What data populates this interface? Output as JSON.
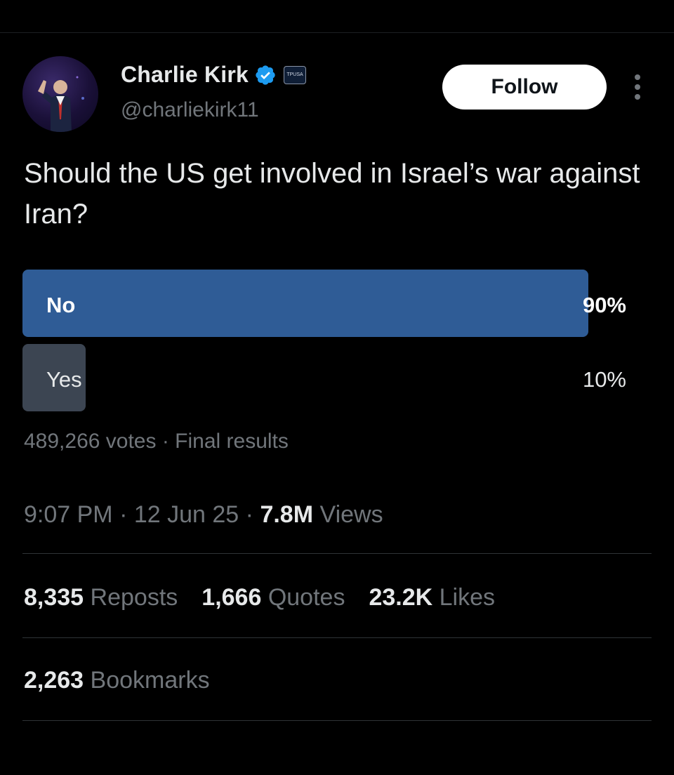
{
  "author": {
    "name": "Charlie Kirk",
    "handle": "@charliekirk11",
    "verified": true,
    "org_badge_text": "TPUSA"
  },
  "follow_label": "Follow",
  "question": "Should the US get involved in Israel’s war against Iran?",
  "poll": {
    "options": [
      {
        "label": "No",
        "percent_text": "90%",
        "fraction": 0.9
      },
      {
        "label": "Yes",
        "percent_text": "10%",
        "fraction": 0.1
      }
    ],
    "votes": "489,266 votes",
    "separator": "·",
    "status": "Final results"
  },
  "timestamp": {
    "time": "9:07 PM",
    "date": "12 Jun 25",
    "views_count": "7.8M",
    "views_label": "Views"
  },
  "stats": {
    "reposts_count": "8,335",
    "reposts_label": "Reposts",
    "quotes_count": "1,666",
    "quotes_label": "Quotes",
    "likes_count": "23.2K",
    "likes_label": "Likes",
    "bookmarks_count": "2,263",
    "bookmarks_label": "Bookmarks"
  },
  "colors": {
    "background": "#000000",
    "winning_option": "#2f5c96",
    "losing_option": "#3c4552",
    "verified_badge": "#1d9bf0",
    "muted_text": "#71767b"
  },
  "icons": [
    "verified-badge-icon",
    "org-badge-icon",
    "more-options-icon"
  ]
}
